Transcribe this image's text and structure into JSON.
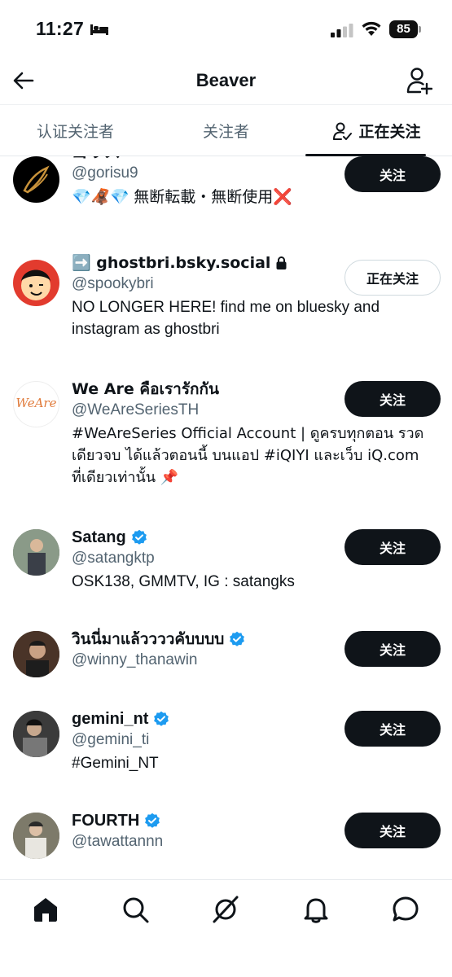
{
  "status_bar": {
    "time": "11:27",
    "battery": "85"
  },
  "header": {
    "title": "Beaver"
  },
  "tabs": [
    {
      "label": "认证关注者"
    },
    {
      "label": "关注者"
    },
    {
      "label": "正在关注"
    }
  ],
  "users": [
    {
      "name": "ゴリス",
      "handle": "@gorisu9",
      "bio_emojis": "💎🦧💎",
      "bio": "無断転載・無断使用❌",
      "button": "关注"
    },
    {
      "name": "➡️ ghostbri.bsky.social",
      "handle": "@spookybri",
      "bio": "NO LONGER HERE! find me on bluesky and instagram as ghostbri",
      "button": "正在关注"
    },
    {
      "name": "We Are คือเรารักกัน",
      "handle": "@WeAreSeriesTH",
      "bio": "#WeAreSeries Official Account | ดูครบทุกตอน รวดเดียวจบ ได้แล้วตอนนี้ บนแอป #iQIYI และเว็บ iQ.com ที่เดียวเท่านั้น 📌",
      "button": "关注",
      "avatar_text": "WeAre"
    },
    {
      "name": "Satang",
      "handle": "@satangktp",
      "bio": "OSK138, GMMTV, IG : satangks",
      "button": "关注"
    },
    {
      "name": "วินนี่มาแล้ววววคับบบบ",
      "handle": "@winny_thanawin",
      "bio": "",
      "button": "关注"
    },
    {
      "name": "gemini_nt",
      "handle": "@gemini_ti",
      "bio": "#Gemini_NT",
      "button": "关注"
    },
    {
      "name": "FOURTH",
      "handle": "@tawattannn",
      "bio": "",
      "button": "关注"
    }
  ],
  "colors": {
    "text": "#0f1419",
    "secondary": "#536471",
    "verified": "#1d9bf0",
    "border": "#cfd9de"
  },
  "bottom_nav": [
    {
      "icon": "home-icon"
    },
    {
      "icon": "search-icon"
    },
    {
      "icon": "grok-icon"
    },
    {
      "icon": "bell-icon"
    },
    {
      "icon": "message-icon"
    }
  ]
}
